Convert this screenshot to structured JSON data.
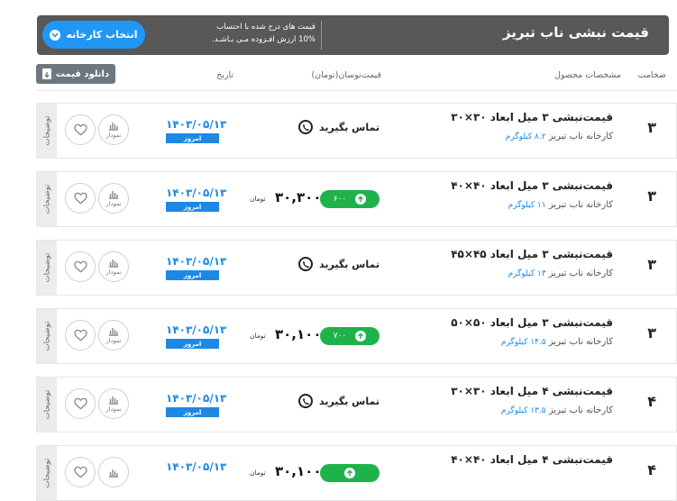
{
  "header": {
    "title": "قیمت نبشی ناب تبریز",
    "note_line1": "قیمت های درج شده با احتساب",
    "note_line2": "10% ارزش افـزوده مـی بـاشـد.",
    "select_button": "انتخاب کارخانه"
  },
  "columns": {
    "thickness": "ضخامت",
    "specs": "مشخصات محصول",
    "price": "قیمت‌نوسان(تومان)",
    "date": "تاریخ"
  },
  "download_label": "دانلود قیمت",
  "rows": [
    {
      "thickness": "۳",
      "name": "قیمت‌نبشی ۳ میل ابعاد ۳۰×۳۰",
      "factory": "کارخانه ناب تبریز",
      "weight": "۸.۲ کیلوگرم",
      "contact": "تماس بگیرید",
      "date": "۱۴۰۳/۰۵/۱۳",
      "today": "امروز",
      "chart": "نمودار",
      "desc": "توضیحات"
    },
    {
      "thickness": "۳",
      "name": "قیمت‌نبشی ۳ میل ابعاد ۴۰×۴۰",
      "factory": "کارخانه ناب تبریز",
      "weight": "۱۱ کیلوگرم",
      "change": "۶۰۰",
      "price": "۳۰,۳۰۰",
      "unit": "تومان",
      "date": "۱۴۰۳/۰۵/۱۳",
      "today": "امروز",
      "chart": "نمودار",
      "desc": "توضیحات"
    },
    {
      "thickness": "۳",
      "name": "قیمت‌نبشی ۳ میل ابعاد ۴۵×۴۵",
      "factory": "کارخانه ناب تبریز",
      "weight": "۱۳ کیلوگرم",
      "contact": "تماس بگیرید",
      "date": "۱۴۰۳/۰۵/۱۳",
      "today": "امروز",
      "chart": "نمودار",
      "desc": "توضیحات"
    },
    {
      "thickness": "۳",
      "name": "قیمت‌نبشی ۳ میل ابعاد ۵۰×۵۰",
      "factory": "کارخانه ناب تبریز",
      "weight": "۱۴.۵ کیلوگرم",
      "change": "۷۰۰",
      "price": "۳۰,۱۰۰",
      "unit": "تومان",
      "date": "۱۴۰۳/۰۵/۱۳",
      "today": "امروز",
      "chart": "نمودار",
      "desc": "توضیحات"
    },
    {
      "thickness": "۴",
      "name": "قیمت‌نبشی ۴ میل ابعاد ۳۰×۳۰",
      "factory": "کارخانه ناب تبریز",
      "weight": "۱۳.۵ کیلوگرم",
      "contact": "تماس بگیرید",
      "date": "۱۴۰۳/۰۵/۱۳",
      "today": "امروز",
      "chart": "نمودار",
      "desc": "توضیحات"
    },
    {
      "thickness": "۴",
      "name": "قیمت‌نبشی ۴ میل ابعاد ۴۰×۴۰",
      "factory": "",
      "weight": "",
      "change": "",
      "price": "۳۰,۱۰۰",
      "unit": "تومان",
      "date": "۱۴۰۳/۰۵/۱۳",
      "today": "",
      "chart": "",
      "desc": "توضیحات"
    }
  ],
  "colors": {
    "accent": "#1e88e5",
    "green": "#20b24a",
    "header_bg": "#585858"
  }
}
